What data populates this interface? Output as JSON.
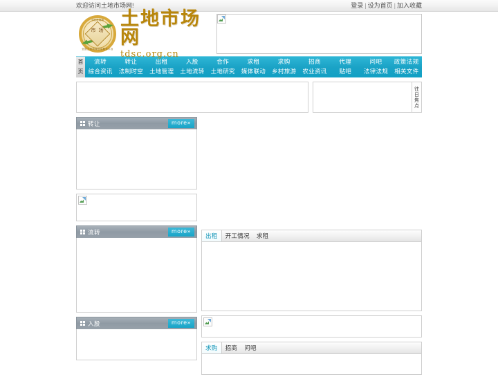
{
  "topbar": {
    "welcome": "欢迎访问土地市场网!",
    "links": [
      "登录",
      "设为首页",
      "加入收藏"
    ],
    "separator": "|"
  },
  "header": {
    "logo_title": "土地市场网",
    "logo_domain": "tdsc.org.cn",
    "emblem": {
      "center_text": "市 场",
      "arc_top": "土地市场网",
      "arc_bottom": "全国土地流转信息服务平台"
    },
    "banner_alt": "broken-image"
  },
  "nav": {
    "home_label": "首页",
    "columns": [
      {
        "top": "流转",
        "bottom": "综合资讯"
      },
      {
        "top": "转让",
        "bottom": "法制时空"
      },
      {
        "top": "出租",
        "bottom": "土地管理"
      },
      {
        "top": "入股",
        "bottom": "土地流转"
      },
      {
        "top": "合作",
        "bottom": "土地研究"
      },
      {
        "top": "求租",
        "bottom": "媒体联动"
      },
      {
        "top": "求购",
        "bottom": "乡村旅游"
      },
      {
        "top": "招商",
        "bottom": "农业资讯"
      },
      {
        "top": "代理",
        "bottom": "贴吧"
      },
      {
        "top": "问吧",
        "bottom": "法律法规"
      },
      {
        "top": "政策法规",
        "bottom": "相关文件"
      }
    ]
  },
  "focus": {
    "vertical_tab": "往日焦点"
  },
  "panels": {
    "zhuanrang": {
      "title": "转让",
      "more": "more»"
    },
    "liuzhuan": {
      "title": "流转",
      "more": "more»"
    },
    "rugu": {
      "title": "入股",
      "more": "more»"
    }
  },
  "tabsets": {
    "chuzu": {
      "tabs": [
        "出租",
        "开工情况",
        "求租"
      ],
      "active": 0
    },
    "qiugou": {
      "tabs": [
        "求购",
        "招商",
        "问吧"
      ],
      "active": 0
    }
  },
  "colors": {
    "nav_teal": "#12a2c5",
    "panel_grey": "#929ca6",
    "logo_gold": "#b8860b",
    "active_tab": "#0e93b6"
  }
}
